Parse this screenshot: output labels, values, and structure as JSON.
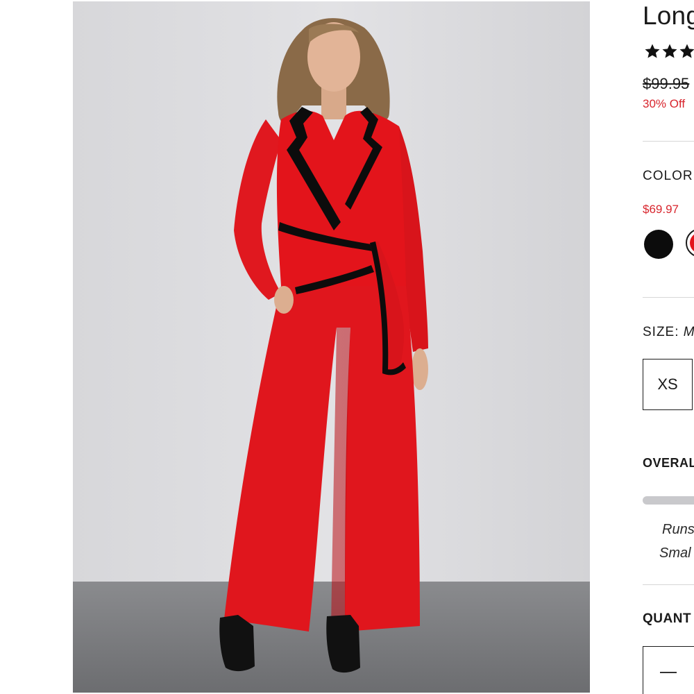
{
  "product": {
    "title": "Long",
    "rating_stars": [
      "★",
      "★",
      "★"
    ],
    "original_price": "$99.95",
    "discount": "30% Off"
  },
  "color": {
    "label": "COLOR",
    "sale_price": "$69.97",
    "swatches": [
      {
        "name": "black",
        "hex": "#0c0c0c"
      },
      {
        "name": "red",
        "hex": "#e3141b",
        "selected": true
      }
    ]
  },
  "size": {
    "label": "SIZE:",
    "selected_value": "M",
    "options": [
      "XS"
    ]
  },
  "fit": {
    "label": "OVERAL",
    "line1": "Runs",
    "line2": "Smal"
  },
  "quantity": {
    "label": "QUANT",
    "minus_symbol": "—"
  },
  "colors": {
    "accent_red": "#d8252d",
    "jumpsuit_red": "#e3141b",
    "trim_black": "#0c0c0c",
    "backdrop": "#dcdcdf",
    "floor": "#7d7e81"
  }
}
